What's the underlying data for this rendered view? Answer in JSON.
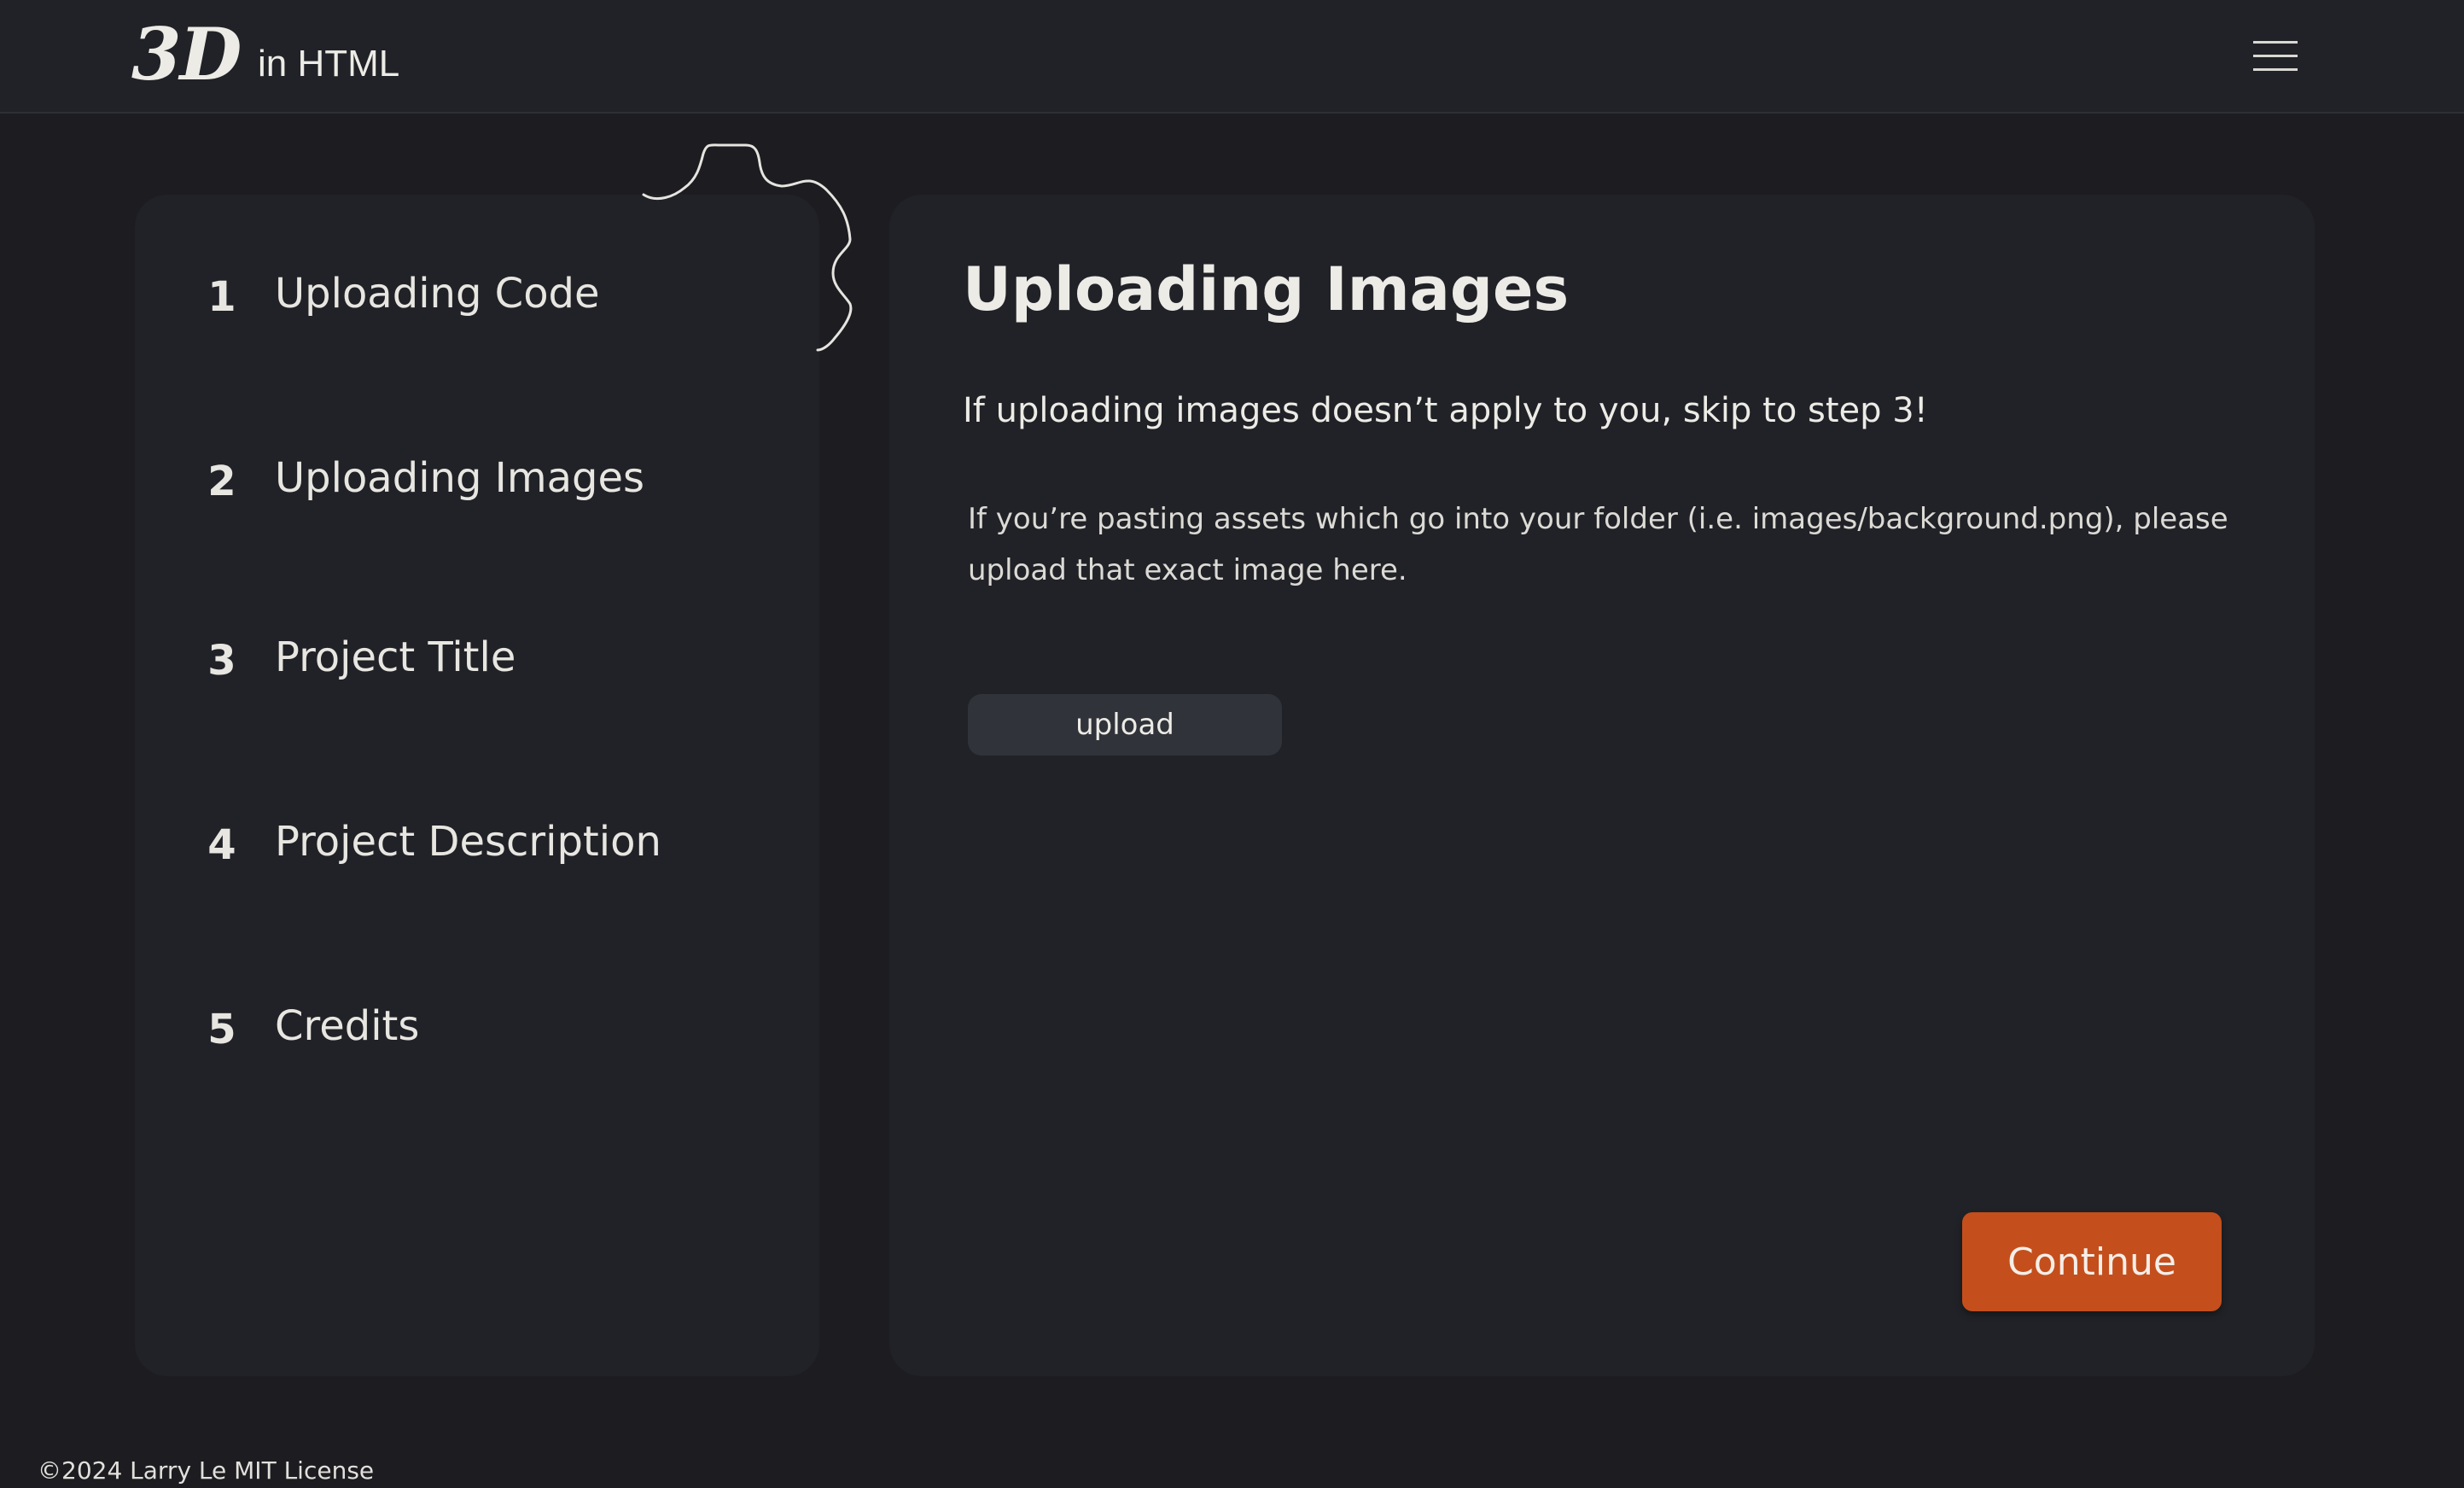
{
  "header": {
    "logo_mark": "3D",
    "logo_text": "in HTML",
    "menu_icon": "hamburger-menu-icon"
  },
  "steps": [
    {
      "number": "1",
      "label": "Uploading Code"
    },
    {
      "number": "2",
      "label": "Uploading Images"
    },
    {
      "number": "3",
      "label": "Project Title"
    },
    {
      "number": "4",
      "label": "Project Description"
    },
    {
      "number": "5",
      "label": "Credits"
    }
  ],
  "content": {
    "title": "Uploading Images",
    "subtitle": "If uploading images doesn’t apply to you, skip to step 3!",
    "description": "If you’re pasting assets which go into your folder (i.e. images/background.png), please upload that exact image here.",
    "upload_label": "upload",
    "continue_label": "Continue"
  },
  "footer": {
    "text": "©2024 Larry Le MIT License"
  },
  "colors": {
    "background": "#1c1c21",
    "panel": "#212227",
    "accent": "#c44f1c",
    "text": "#e8e6e1"
  }
}
